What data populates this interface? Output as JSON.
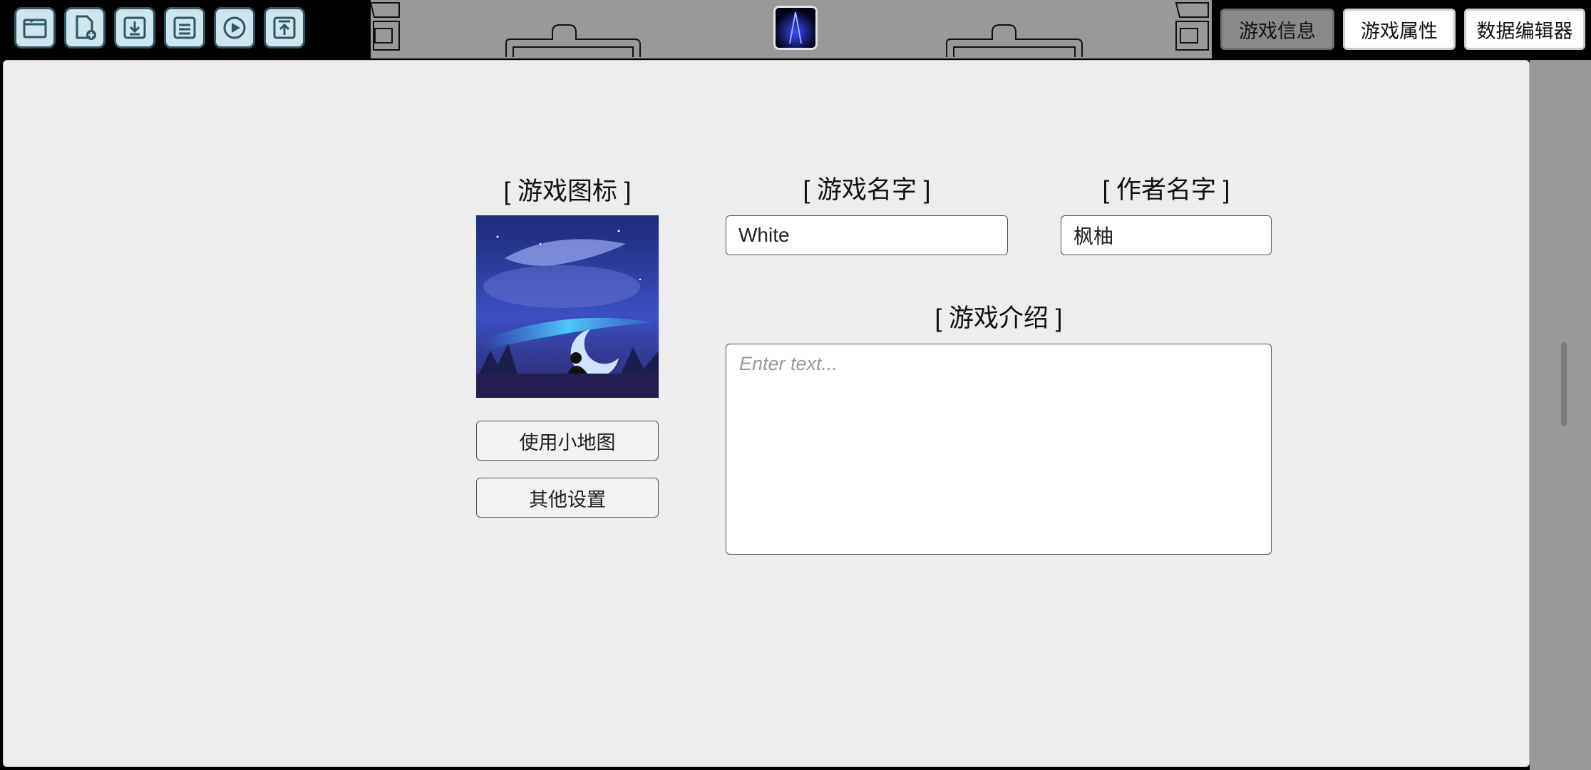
{
  "toolbar": {
    "buttons": [
      {
        "icon": "folder-open-icon"
      },
      {
        "icon": "new-file-icon"
      },
      {
        "icon": "download-icon"
      },
      {
        "icon": "save-icon"
      },
      {
        "icon": "play-icon"
      },
      {
        "icon": "upload-icon"
      }
    ]
  },
  "tabs": {
    "info": "游戏信息",
    "attributes": "游戏属性",
    "data_editor": "数据编辑器"
  },
  "panel": {
    "icon_title": "[ 游戏图标 ]",
    "name_title": "[ 游戏名字 ]",
    "author_title": "[ 作者名字 ]",
    "intro_title": "[ 游戏介绍 ]",
    "game_name": "White",
    "author_name": "枫柚",
    "intro_placeholder": "Enter text...",
    "minimap_button": "使用小地图",
    "other_settings_button": "其他设置"
  },
  "colors": {
    "panel_bg": "#ededed",
    "active_tab": "#8a8a8a",
    "tool_button_bg": "#cfe6ee",
    "tool_button_border": "#2f5663"
  }
}
